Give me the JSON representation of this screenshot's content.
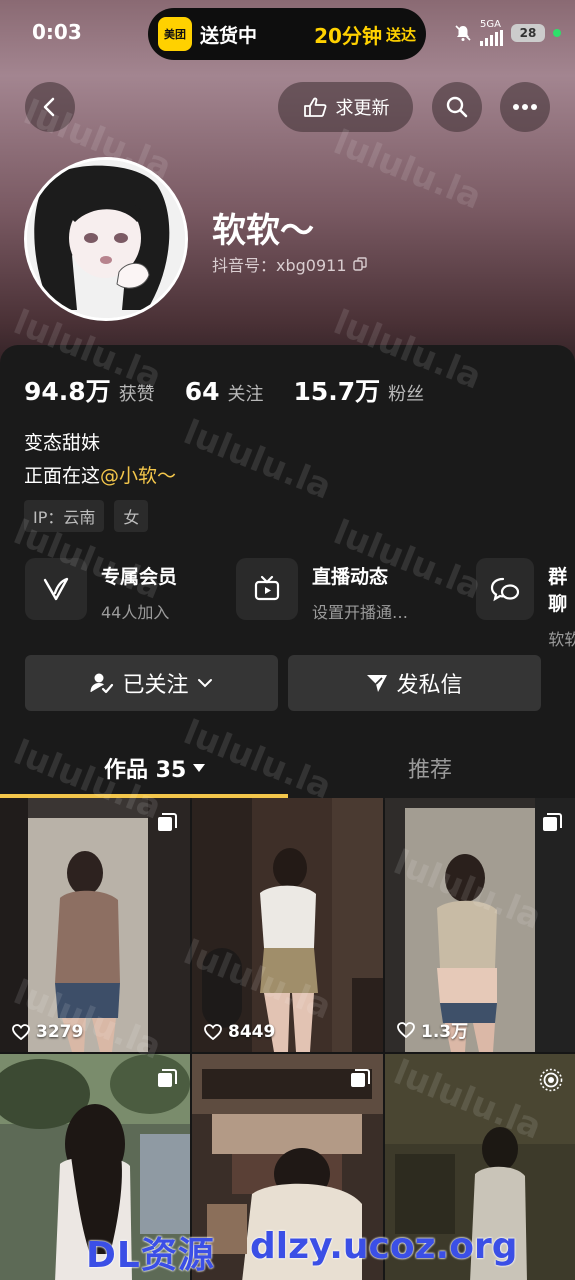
{
  "status_bar": {
    "time": "0:03",
    "island_logo": "美团",
    "island_left": "送货中",
    "island_num": "20分钟",
    "island_right": "送达",
    "network": "5GA",
    "battery": "28"
  },
  "nav": {
    "request_update_label": "求更新"
  },
  "profile": {
    "nickname": "软软～",
    "douyin_id": "抖音号：xbg0911"
  },
  "stats": [
    {
      "value": "94.8万",
      "label": "获赞"
    },
    {
      "value": "64",
      "label": "关注"
    },
    {
      "value": "15.7万",
      "label": "粉丝"
    }
  ],
  "bio": {
    "line1": "变态甜妹",
    "line2_prefix": "正面在这",
    "line2_mention": "@小软～"
  },
  "tags": [
    "IP：云南",
    "女"
  ],
  "features": [
    {
      "title": "专属会员",
      "subtitle": "44人加入",
      "icon": "v-member-icon"
    },
    {
      "title": "直播动态",
      "subtitle": "设置开播通…",
      "icon": "tv-icon"
    },
    {
      "title": "群聊",
      "subtitle": "软软",
      "icon": "chat-bubbles-icon"
    }
  ],
  "actions": {
    "follow_label": "已关注",
    "message_label": "发私信"
  },
  "tabs": {
    "works_label": "作品 35",
    "recommend_label": "推荐"
  },
  "videos": [
    {
      "likes": "3279",
      "corner": "multi-image-icon"
    },
    {
      "likes": "8449",
      "corner": ""
    },
    {
      "likes": "1.3万",
      "corner": "multi-image-icon"
    },
    {
      "likes": "",
      "corner": "multi-image-icon"
    },
    {
      "likes": "",
      "corner": "multi-image-icon"
    },
    {
      "likes": "",
      "corner": "live-photo-icon"
    }
  ],
  "watermark": "lululu.la",
  "footer_watermark_left": "DL资源",
  "footer_watermark_right": "dlzy.ucoz.org",
  "colors": {
    "accent": "#f3c64b",
    "background": "#1a1a1a",
    "header_gradient_top": "#a38590"
  }
}
